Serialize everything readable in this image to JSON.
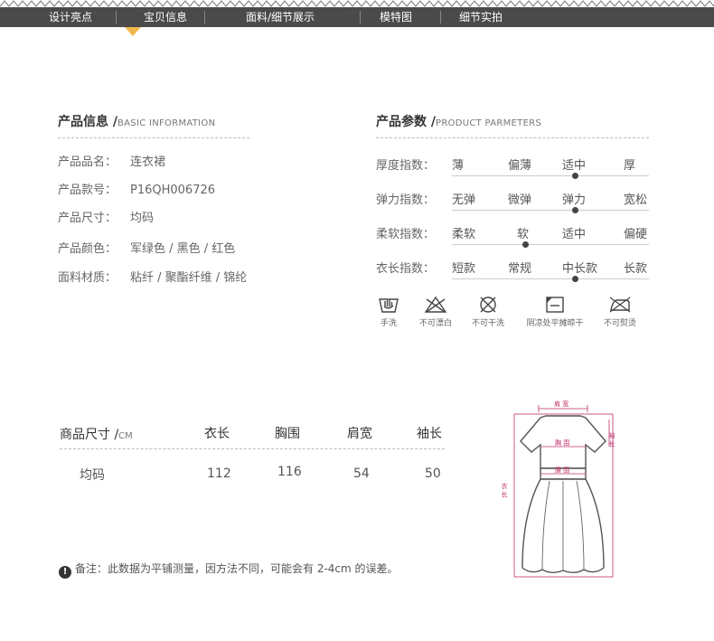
{
  "nav": {
    "items": [
      "设计亮点",
      "宝贝信息",
      "面料/细节展示",
      "模特图",
      "细节实拍"
    ],
    "active": "宝贝信息",
    "bar_color": "#4a4a4a",
    "accent_color": "#f0b84b"
  },
  "basic_info": {
    "title": "产品信息 /",
    "subtitle": "BASIC INFORMATION",
    "rows": [
      {
        "key": "产品品名：",
        "value": "连衣裙"
      },
      {
        "key": "产品款号：",
        "value": "P16QH006726"
      },
      {
        "key": "产品尺寸：",
        "value": "均码"
      },
      {
        "key": "产品颜色：",
        "value": "军绿色 / 黑色 / 红色"
      },
      {
        "key": "面料材质：",
        "value": "粘纤 / 聚酯纤维 / 锦纶"
      }
    ]
  },
  "params": {
    "title": "产品参数 /",
    "subtitle": "PRODUCT PARMETERS",
    "rows": [
      {
        "label": "厚度指数：",
        "options": [
          "薄",
          "偏薄",
          "适中",
          "厚"
        ],
        "selected_index": 2
      },
      {
        "label": "弹力指数：",
        "options": [
          "无弹",
          "微弹",
          "弹力",
          "宽松"
        ],
        "selected_index": 2
      },
      {
        "label": "柔软指数：",
        "options": [
          "柔软",
          "软",
          "适中",
          "偏硬"
        ],
        "selected_index": 1
      },
      {
        "label": "衣长指数：",
        "options": [
          "短款",
          "常规",
          "中长款",
          "长款"
        ],
        "selected_index": 2
      }
    ]
  },
  "care": [
    {
      "icon": "hand-wash-icon",
      "label": "手洗"
    },
    {
      "icon": "no-bleach-icon",
      "label": "不可漂白"
    },
    {
      "icon": "no-dry-clean-icon",
      "label": "不可干洗"
    },
    {
      "icon": "shade-dry-flat-icon",
      "label": "阴凉处平摊晾干"
    },
    {
      "icon": "no-iron-icon",
      "label": "不可熨烫"
    }
  ],
  "size_table": {
    "title": "商品尺寸 /",
    "unit": "CM",
    "headers": [
      "衣长",
      "胸围",
      "肩宽",
      "袖长"
    ],
    "rows": [
      {
        "size": "均码",
        "values": [
          "112",
          "116",
          "54",
          "50"
        ]
      }
    ]
  },
  "note": {
    "text": "备注：此数据为平铺测量，因方法不同，可能会有 2-4cm 的误差。"
  },
  "diagram": {
    "labels": {
      "shoulder": "肩 宽",
      "sleeve": "袖 长",
      "chest": "胸 围",
      "waist": "腰 围",
      "length": "衣 长"
    },
    "measure_color": "#c0306a"
  }
}
